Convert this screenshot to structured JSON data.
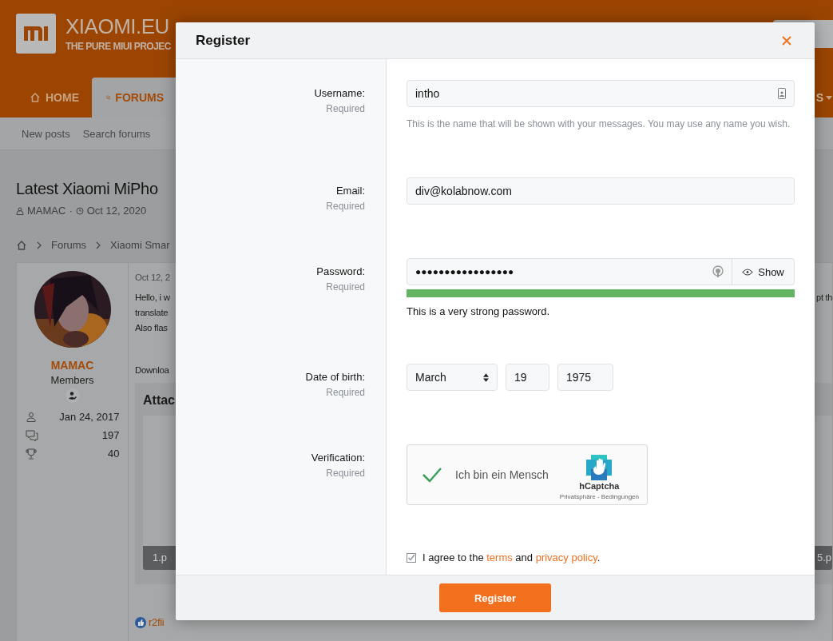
{
  "header": {
    "logo_title": "XIAOMI.EU",
    "logo_subtitle": "THE PURE MIUI PROJEC"
  },
  "nav": [
    {
      "label": "HOME",
      "selected": false
    },
    {
      "label": "FORUMS",
      "selected": true
    }
  ],
  "nav_right": "S",
  "subnav": [
    "New posts",
    "Search forums"
  ],
  "thread": {
    "title": "Latest Xiaomi MiPho",
    "author": "MAMAC",
    "separator": "·",
    "date": "Oct 12, 2020"
  },
  "breadcrumb": [
    "Forums",
    "Xiaomi Smar"
  ],
  "post": {
    "user": {
      "name": "MAMAC",
      "group": "Members",
      "joined": "Jan 24, 2017",
      "messages": "197",
      "points": "40"
    },
    "date": "Oct 12, 2",
    "lines": [
      "Hello, i w",
      "translate",
      "Also flas"
    ],
    "right_fragment": "pt th",
    "download": "Downloa",
    "attachments_title": "Attac",
    "attachments": [
      "1.p",
      "5.p"
    ],
    "reaction": "r2fii"
  },
  "modal": {
    "title": "Register",
    "fields": [
      {
        "kind": "text",
        "label": "Username:",
        "hint": "Required",
        "value": "intho",
        "explain": "This is the name that will be shown with your messages. You may use any name you wish."
      },
      {
        "kind": "text",
        "label": "Email:",
        "hint": "Required",
        "value": "div@kolabnow.com"
      },
      {
        "kind": "password",
        "label": "Password:",
        "hint": "Required",
        "value": "●●●●●●●●●●●●●●●●●",
        "show": "Show",
        "level": 1,
        "strength": "This is a very strong password."
      },
      {
        "kind": "date",
        "label": "Date of birth:",
        "hint": "Required",
        "month": "March",
        "day": "19",
        "year": "1975"
      },
      {
        "kind": "captcha",
        "label": "Verification:",
        "hint": "Required",
        "checked": true,
        "text": "Ich bin ein Mensch",
        "brand": "hCaptcha",
        "links": "Privatsphäre - Bedingungen"
      }
    ],
    "agree": {
      "checked": true,
      "before": "I agree to the",
      "terms": "terms",
      "middle": "and",
      "privacy": "privacy policy",
      "after": "."
    },
    "submit": "Register"
  }
}
